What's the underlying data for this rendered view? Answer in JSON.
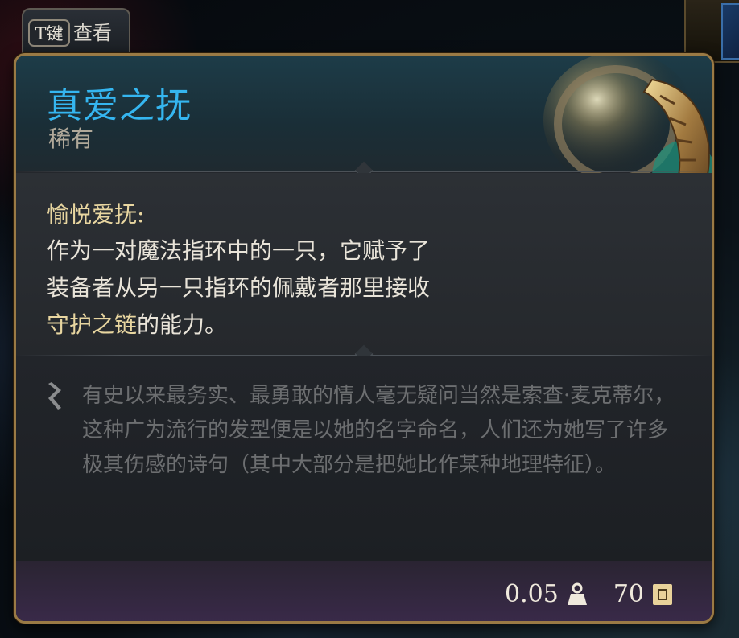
{
  "key_hint": {
    "key": "T键",
    "label": "查看"
  },
  "item": {
    "name": "真爱之抚",
    "rarity": "稀有",
    "icon": "gold-ring-icon"
  },
  "effect": {
    "title": "愉悦爱抚:",
    "line1": "作为一对魔法指环中的一只，它赋予了",
    "line2": "装备者从另一只指环的佩戴者那里接收",
    "highlight": "守护之链",
    "line3_tail": "的能力。"
  },
  "lore": {
    "icon": "quill-icon",
    "text": "有史以来最务实、最勇敢的情人毫无疑问当然是索查·麦克蒂尔，这种广为流行的发型便是以她的名字命名，人们还为她写了许多极其伤感的诗句（其中大部分是把她比作某种地理特征）。"
  },
  "footer": {
    "weight": "0.05",
    "weight_icon": "weight-icon",
    "value": "70",
    "value_icon": "gold-coin-icon"
  },
  "colors": {
    "name": "#35b6f0",
    "border": "#9a7a45",
    "effect_title": "#e8d6a0",
    "lore_text": "#6c6e70"
  }
}
